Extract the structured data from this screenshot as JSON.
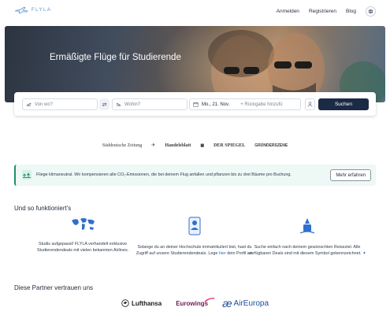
{
  "header": {
    "logo_text": "FLYLA",
    "nav": {
      "login": "Anmelden",
      "register": "Registrieren",
      "blog": "Blog"
    }
  },
  "hero": {
    "title": "Ermäßigte Flüge für Studierende"
  },
  "search": {
    "from_placeholder": "Von wo?",
    "to_placeholder": "Wohin?",
    "date": "Mo., 21. Nov.",
    "return_label": "+ Rückgabe hinzufü",
    "search_button": "Suchen"
  },
  "press": [
    "Süddeutsche Zeitung",
    "Handelsblatt",
    "DER SPIEGEL",
    "GRÜNDERSZENE"
  ],
  "banner": {
    "text": "Fliege klimaneutral. Wir kompensieren alle CO₂-Emissionen, die bei deinem Flug anfallen und pflanzen bis zu drei Bäume pro Buchung.",
    "button": "Mehr erfahren"
  },
  "how": {
    "title": "Und so funktioniert's",
    "col1": "Studis aufgepasst! FLYLA verhandelt exklusive Studierendendeals mit vielen bekannten Airlines.",
    "col2_pre": "Solange du an deiner Hochschule immatrikuliert bist, hast du Zugriff auf unsere Studierendendeals. Lege ",
    "col2_link": "hier",
    "col2_post": " dein Profil an.",
    "col3": "Suche einfach nach deinem gewünschten Reiseziel. Alle verfügbaren Deals sind mit diesem Symbol gekennzeichnet."
  },
  "partners": {
    "title": "Diese Partner vertrauen uns",
    "items": [
      "Lufthansa",
      "Eurowings",
      "AirEuropa"
    ]
  },
  "colors": {
    "primary": "#1c2b45",
    "accent": "#5b8fd6",
    "banner_bg": "#eef8f5",
    "banner_border": "#1d8f6f"
  }
}
